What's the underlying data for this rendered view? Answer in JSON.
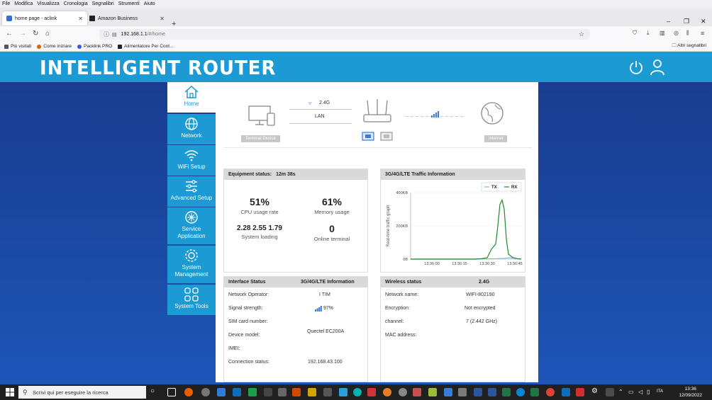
{
  "browser": {
    "menu": [
      "File",
      "Modifica",
      "Visualizza",
      "Cronologia",
      "Segnalibri",
      "Strumenti",
      "Aiuto"
    ],
    "tabs": [
      {
        "label": "home page - aclink",
        "active": true
      },
      {
        "label": "Amazon Business",
        "active": false
      }
    ],
    "url_host": "192.168.1.1",
    "url_path": "/#/home",
    "bookmarks": [
      "Più visitati",
      "Come iniziare",
      "Packlink PRO",
      "Alimentatore Per Cont..."
    ],
    "other_bookmarks": "Altri segnalibri"
  },
  "router": {
    "brand": "INTELLIGENT ROUTER",
    "sidebar": [
      {
        "label": "Home",
        "icon": "home-icon"
      },
      {
        "label": "Network",
        "icon": "globe-icon"
      },
      {
        "label": "WiFi Setup",
        "icon": "wifi-icon"
      },
      {
        "label": "Advanced Setup",
        "icon": "sliders-icon"
      },
      {
        "label": "Service Application",
        "icon": "service-icon"
      },
      {
        "label": "System Management",
        "icon": "gear-icon"
      },
      {
        "label": "System Tools",
        "icon": "tools-icon"
      }
    ],
    "topology": {
      "terminal_caption": "Terminal Device",
      "band": "2.4G",
      "lan": "LAN",
      "internet_caption": "Internet"
    },
    "equipment": {
      "title": "Equipment status:",
      "uptime": "12m 38s",
      "cpu_value": "51%",
      "cpu_label": "CPU usage rate",
      "mem_value": "61%",
      "mem_label": "Memory usage",
      "load_value": "2.28 2.55 1.79",
      "load_label": "System loading",
      "online_value": "0",
      "online_label": "Online terminal"
    },
    "traffic": {
      "title": "3G/4G/LTE Traffic Information"
    },
    "interface": {
      "title": "Interface Status",
      "subtitle": "3G/4G/LTE Information",
      "rows": [
        {
          "label": "Network Operator:",
          "value": "I TIM"
        },
        {
          "label": "Signal strength:",
          "value": "97%"
        },
        {
          "label": "SIM card number:",
          "value": ""
        },
        {
          "label": "Device model:",
          "value": "Quectel EC200A"
        },
        {
          "label": "IMEI:",
          "value": ""
        },
        {
          "label": "Connection status:",
          "value": "192.168.43.100"
        }
      ]
    },
    "wireless": {
      "title": "Wireless status",
      "band": "2.4G",
      "rows": [
        {
          "label": "Network name:",
          "value": "WIFI-802190"
        },
        {
          "label": "Encryption:",
          "value": "Not encrypted"
        },
        {
          "label": "channel:",
          "value": "7 (2.442 GHz)"
        },
        {
          "label": "MAC address:",
          "value": ""
        }
      ]
    }
  },
  "chart_data": {
    "type": "line",
    "ylabel": "Real-time traffic graph",
    "x": [
      "13:36:00",
      "13:36:15",
      "13:36:30",
      "13:36:45"
    ],
    "yticks": [
      "0B",
      "200KB",
      "400KB"
    ],
    "ylim": [
      0,
      400
    ],
    "legend_position": "top-right",
    "series": [
      {
        "name": "TX",
        "color": "#7fb7e8",
        "points": [
          [
            0,
            0
          ],
          [
            5,
            0
          ],
          [
            10,
            0
          ],
          [
            15,
            0
          ],
          [
            20,
            0
          ],
          [
            25,
            0
          ],
          [
            30,
            0
          ],
          [
            35,
            1
          ],
          [
            38,
            2
          ],
          [
            41,
            3
          ],
          [
            44,
            5
          ],
          [
            47,
            8
          ],
          [
            50,
            3
          ],
          [
            52,
            0
          ]
        ]
      },
      {
        "name": "RX",
        "color": "#1f8a2a",
        "points": [
          [
            0,
            0
          ],
          [
            5,
            0
          ],
          [
            10,
            0
          ],
          [
            15,
            0
          ],
          [
            20,
            0
          ],
          [
            25,
            0
          ],
          [
            30,
            0
          ],
          [
            33,
            2
          ],
          [
            36,
            8
          ],
          [
            38,
            60
          ],
          [
            40,
            90
          ],
          [
            41,
            200
          ],
          [
            42,
            330
          ],
          [
            43,
            355
          ],
          [
            44,
            300
          ],
          [
            45,
            120
          ],
          [
            46,
            30
          ],
          [
            48,
            10
          ],
          [
            50,
            3
          ],
          [
            52,
            0
          ]
        ]
      }
    ]
  },
  "taskbar": {
    "search_placeholder": "Scrivi qui per eseguire la ricerca",
    "lang": "ITA",
    "time": "13:36",
    "date": "12/09/2022"
  },
  "colors": {
    "header_blue": "#1b9ad4",
    "background_blue": "#1b4aa4",
    "rx_green": "#1f8a2a",
    "tx_blue": "#7fb7e8"
  }
}
